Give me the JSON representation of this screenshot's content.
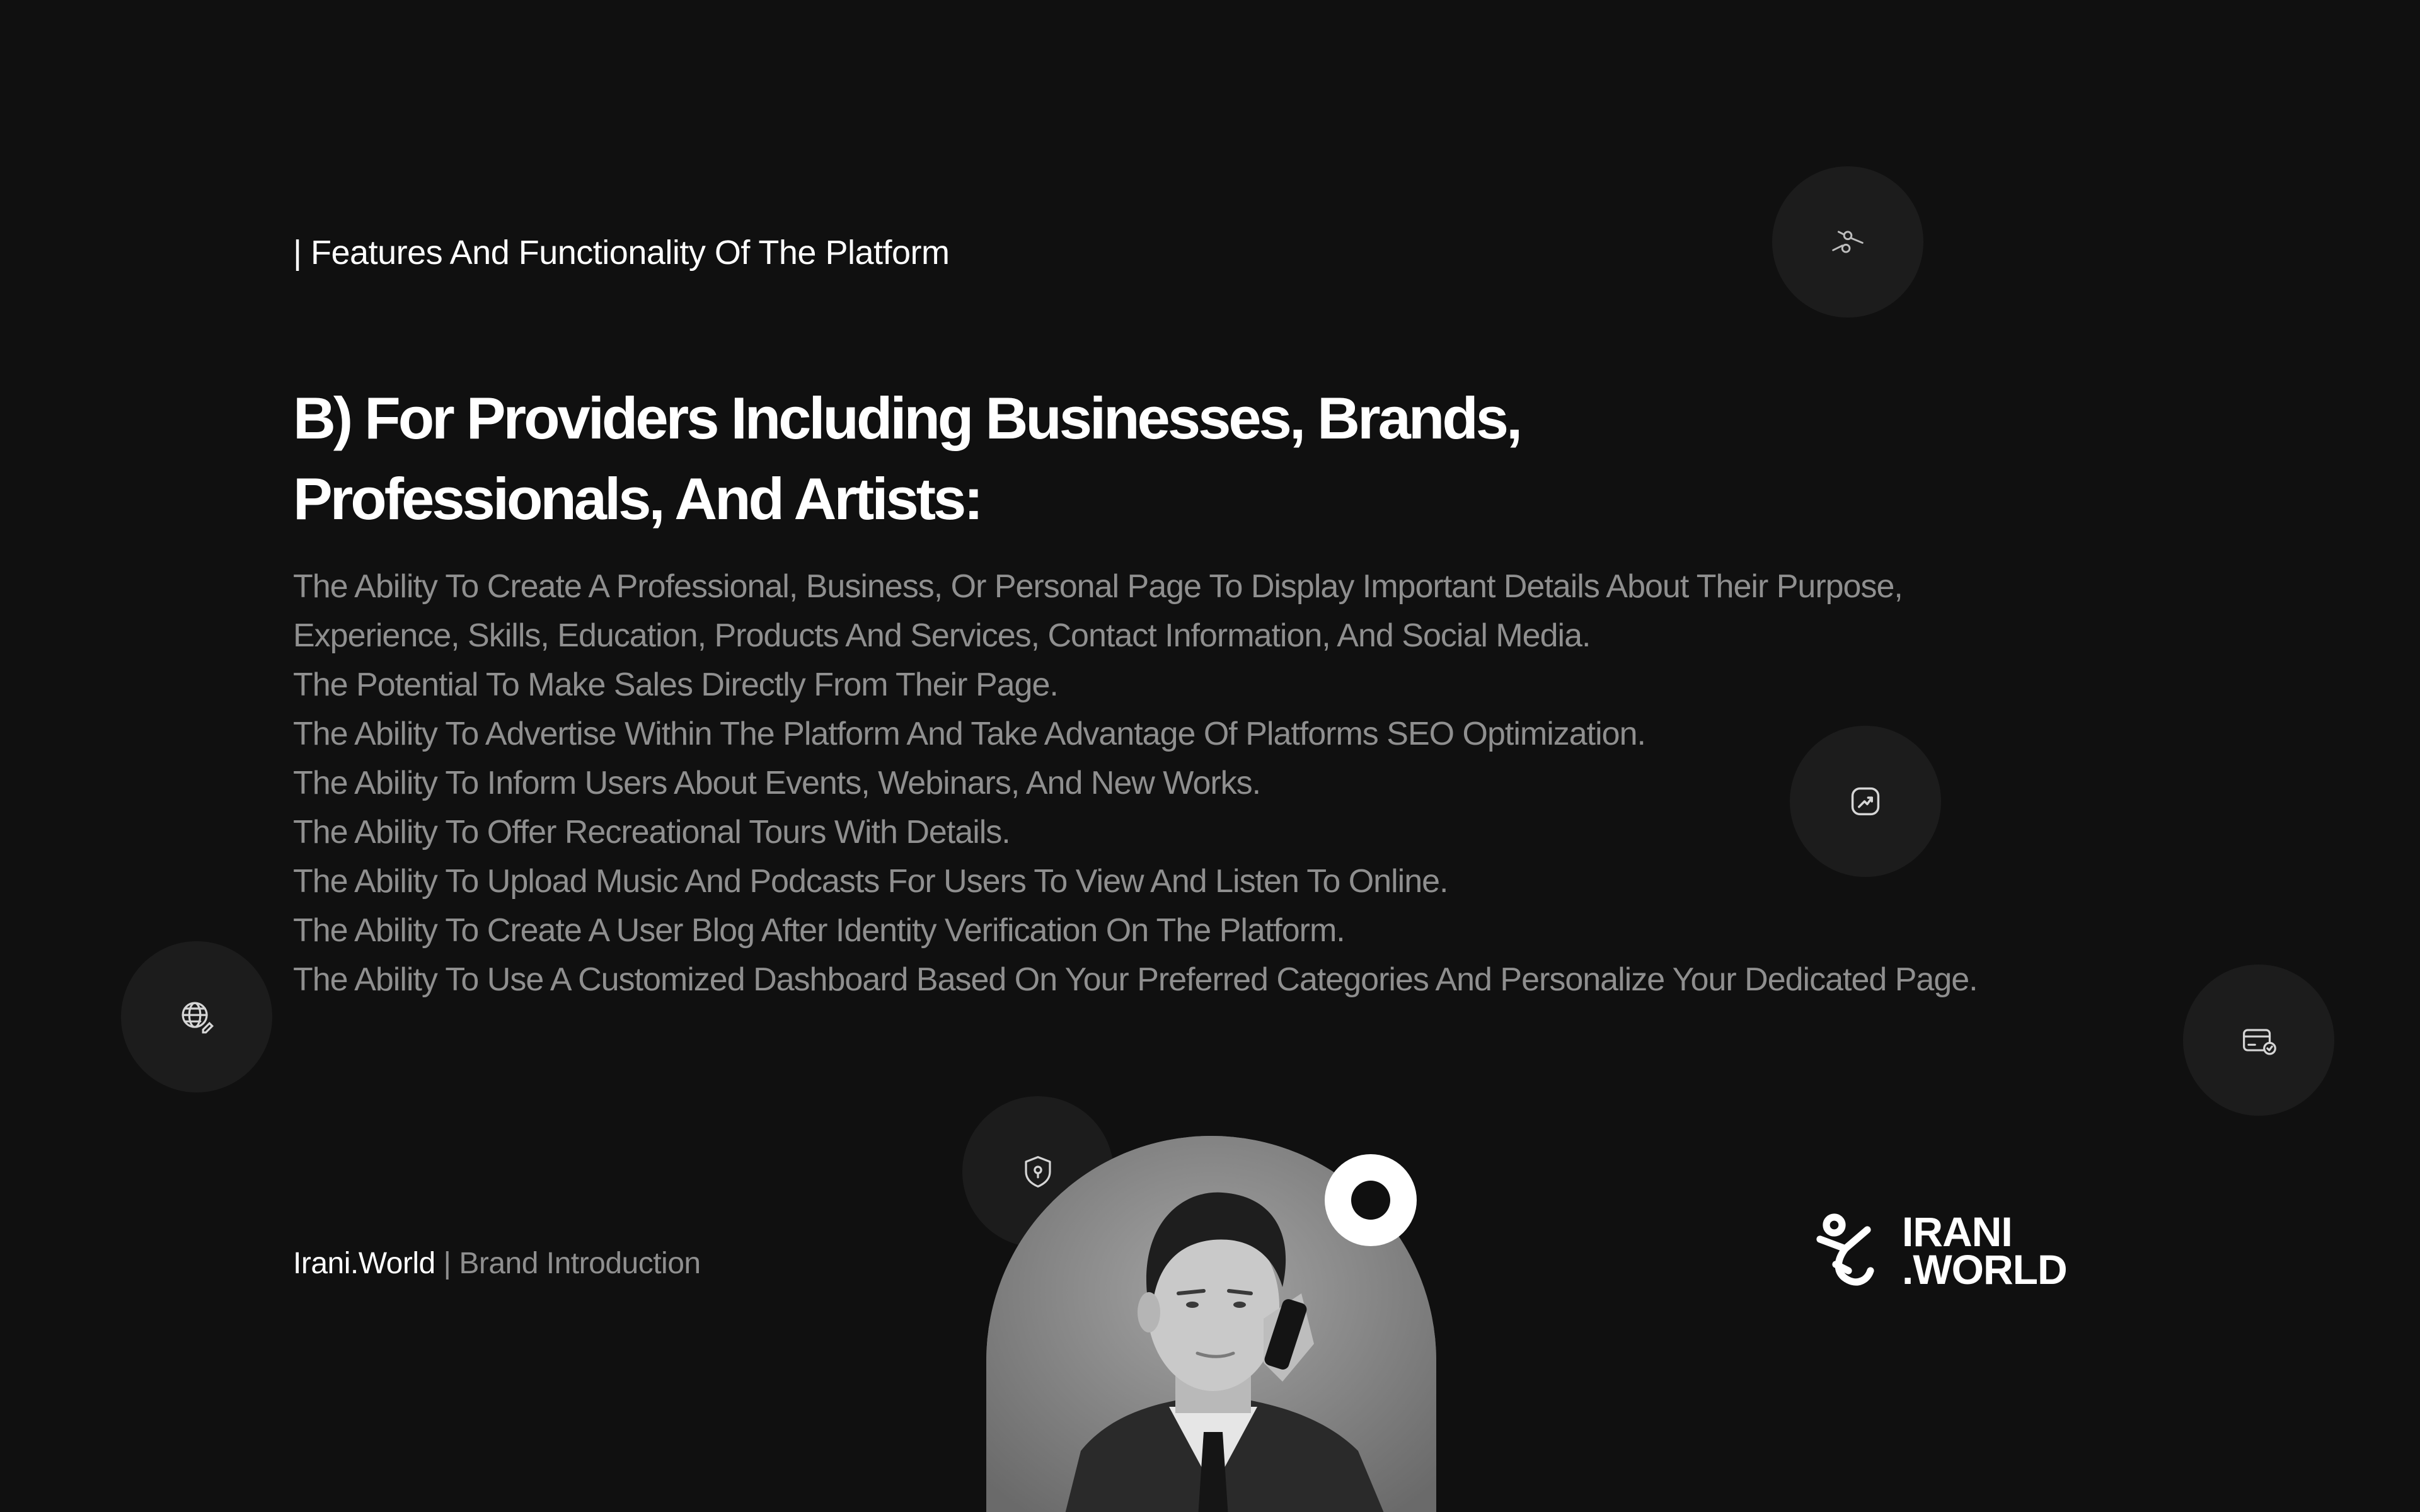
{
  "header": {
    "section_label": "| Features And Functionality Of The Platform"
  },
  "main": {
    "heading_line1": "B) For Providers Including Businesses, Brands,",
    "heading_line2": "Professionals, And Artists:",
    "features": [
      "The Ability To Create A Professional, Business, Or Personal Page To Display Important Details About Their Purpose,",
      "Experience, Skills, Education, Products And Services, Contact Information, And Social Media.",
      "The Potential To Make Sales Directly From Their Page.",
      "The Ability To Advertise Within The Platform And Take Advantage Of Platforms SEO Optimization.",
      "The Ability To Inform Users About Events, Webinars, And New Works.",
      "The Ability To Offer Recreational Tours With Details.",
      "The Ability To Upload Music And Podcasts For Users To View And Listen To Online.",
      "The Ability To Create A User Blog After Identity Verification On The Platform.",
      "The Ability To Use A Customized Dashboard Based On Your Preferred Categories And Personalize Your Dedicated Page."
    ]
  },
  "footer": {
    "brand_name": "Irani.World",
    "separator": "|",
    "brand_subtitle": "Brand Introduction"
  },
  "logo": {
    "line1": "IRANI",
    "line2": ".WORLD"
  },
  "icons": {
    "top_circle": "connection-icon",
    "middle_circle": "trend-up-icon",
    "left_circle": "globe-edit-icon",
    "right_circle": "card-check-icon",
    "shield_circle": "shield-location-icon"
  },
  "colors": {
    "background": "#101010",
    "heading": "#ffffff",
    "body_text": "#8f8f8f",
    "circle_bg": "#1c1c1c"
  }
}
